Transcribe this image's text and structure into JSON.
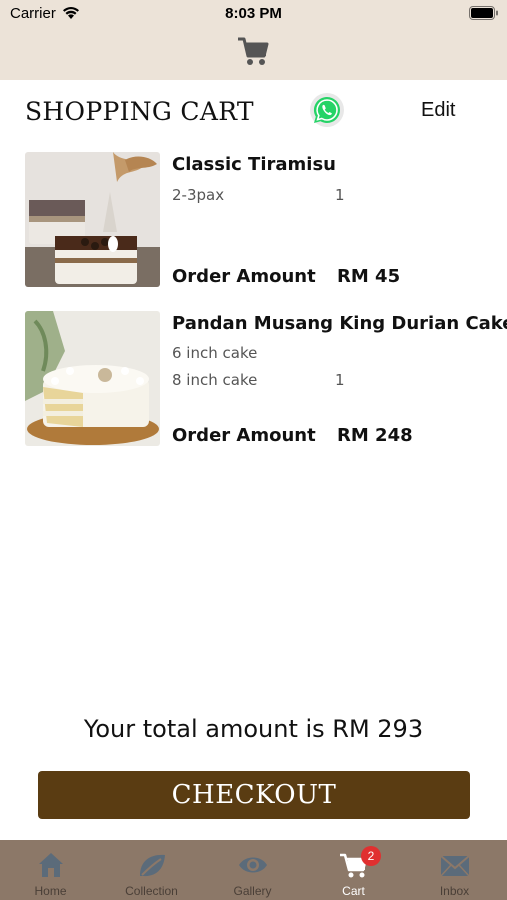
{
  "status_bar": {
    "carrier": "Carrier",
    "time": "8:03 PM"
  },
  "header": {
    "title": "SHOPPING CART",
    "edit_label": "Edit"
  },
  "cart_items": [
    {
      "name": "Classic Tiramisu",
      "options": [
        "2-3pax"
      ],
      "quantity": "1",
      "amount_label": "Order Amount",
      "amount": "RM 45"
    },
    {
      "name": "Pandan Musang King Durian Cake",
      "options": [
        "6 inch cake",
        "8 inch cake"
      ],
      "quantity": "1",
      "amount_label": "Order Amount",
      "amount": "RM 248"
    }
  ],
  "total_text": "Your total amount is RM 293",
  "checkout_label": "CHECKOUT",
  "tabs": [
    {
      "label": "Home",
      "icon": "home-icon"
    },
    {
      "label": "Collection",
      "icon": "leaf-icon"
    },
    {
      "label": "Gallery",
      "icon": "eye-icon"
    },
    {
      "label": "Cart",
      "icon": "cart-icon",
      "badge": "2",
      "active": true
    },
    {
      "label": "Inbox",
      "icon": "envelope-icon"
    }
  ],
  "colors": {
    "header_bg": "#ece3d8",
    "checkout_bg": "#5a3c12",
    "tabbar_bg": "#8c7868",
    "badge": "#e03030",
    "whatsapp": "#25d366"
  }
}
